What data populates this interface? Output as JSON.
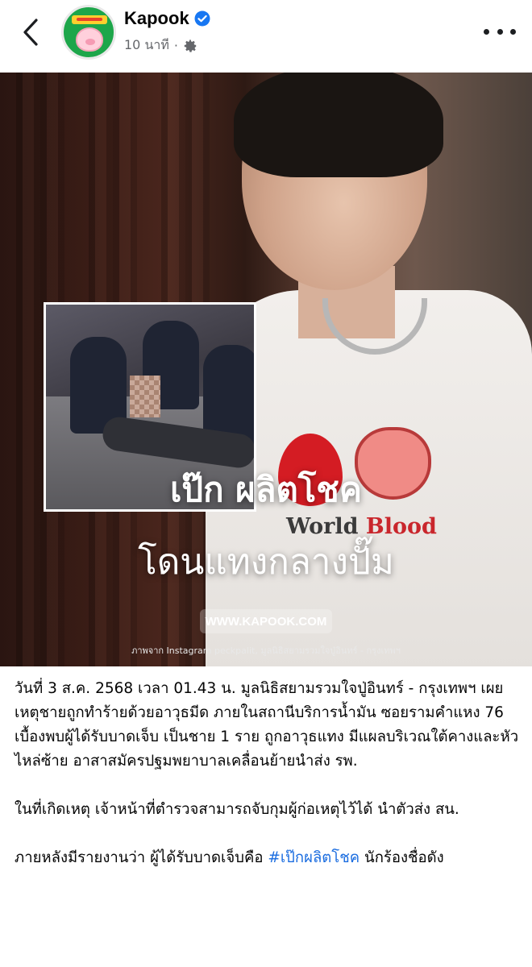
{
  "header": {
    "page_name": "Kapook",
    "time_text": "10 นาที",
    "separator": "·"
  },
  "photo": {
    "headline": "เป๊ก ผลิตโชค",
    "subhead": "โดนแทงกลางปั๊ม",
    "watermark": "WWW.KAPOOK.COM",
    "credit": "ภาพจาก Instagram peckpalit, มูลนิธิสยามรวมใจปู่อินทร์ - กรุงเทพฯ",
    "shirt_text_1": "World ",
    "shirt_text_2": "Blood"
  },
  "post": {
    "paragraph_1": "วันที่ 3 ส.ค. 2568 เวลา 01.43 น. มูลนิธิสยามรวมใจปู่อินทร์ - กรุงเทพฯ เผยเหตุชายถูกทำร้ายด้วยอาวุธมีด ภายในสถานีบริการน้ำมัน ซอยรามคำแหง 76 เบื้องพบผู้ได้รับบาดเจ็บ เป็นชาย 1 ราย ถูกอาวุธแทง มีแผลบริเวณใต้คางและหัวไหล่ซ้าย อาสาสมัครปฐมพยาบาลเคลื่อนย้ายนำส่ง รพ.",
    "paragraph_2": "ในที่เกิดเหตุ เจ้าหน้าที่ตำรวจสามารถจับกุมผู้ก่อเหตุไว้ได้ นำตัวส่ง สน.",
    "paragraph_3_before": "ภายหลังมีรายงานว่า ผู้ได้รับบาดเจ็บคือ ",
    "hashtag": "#เป๊กผลิตโชค",
    "paragraph_3_after": " นักร้องชื่อดัง"
  },
  "colors": {
    "link": "#1b6de0",
    "verified": "#1877f2",
    "meta_text": "#65676b"
  },
  "icons": [
    "back-arrow-icon",
    "verified-badge-icon",
    "gear-icon",
    "more-icon"
  ]
}
